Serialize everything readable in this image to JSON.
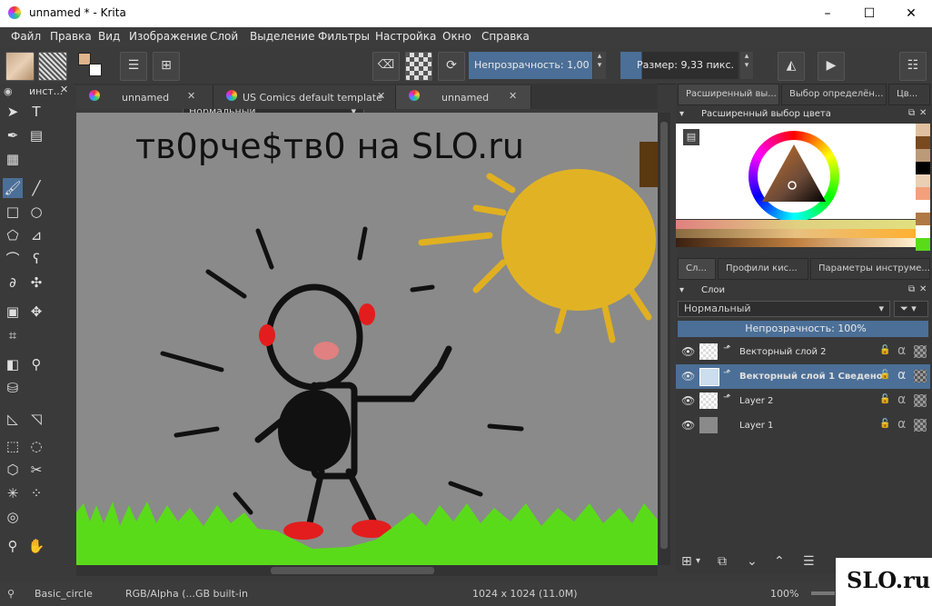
{
  "window": {
    "title": "unnamed * - Krita",
    "minimize_label": "–",
    "maximize_label": "☐",
    "close_label": "✕"
  },
  "menu": {
    "items": [
      "Файл",
      "Правка",
      "Вид",
      "Изображение",
      "Слой",
      "Выделение",
      "Фильтры",
      "Настройка",
      "Окно",
      "Справка"
    ]
  },
  "toolbar": {
    "blend_mode": "Нормальный",
    "opacity_label": "Непрозрачность:  1,00",
    "size_label": "Размер:  9,33 пикс."
  },
  "toolbox": {
    "header": "инст..."
  },
  "tabs": [
    {
      "label": "unnamed"
    },
    {
      "label": "US Comics default template"
    },
    {
      "label": "unnamed"
    }
  ],
  "canvas": {
    "headline": "тв0рче$тв0 на SLO.ru"
  },
  "docker": {
    "top_tabs": [
      "Расширенный вы...",
      "Выбор определён...",
      "Цв..."
    ],
    "color_selector_title": "Расширенный выбор цвета",
    "layer_tabs": [
      "Сл...",
      "Профили кис...",
      "Параметры инструме..."
    ],
    "layers_title": "Слои",
    "blend_mode": "Нормальный",
    "opacity_label": "Непрозрачность:  100%",
    "layers": [
      {
        "name": "Векторный слой 2",
        "selected": false
      },
      {
        "name": "Векторный слой 1 Сведено",
        "selected": true
      },
      {
        "name": "Layer 2",
        "selected": false
      },
      {
        "name": "Layer 1",
        "selected": false
      }
    ]
  },
  "status": {
    "brush": "Basic_circle",
    "colorspace": "RGB/Alpha (...GB built-in",
    "dimensions": "1024 x 1024 (11.0M)",
    "zoom": "100%"
  },
  "watermark": {
    "text": "SLO.ru"
  }
}
